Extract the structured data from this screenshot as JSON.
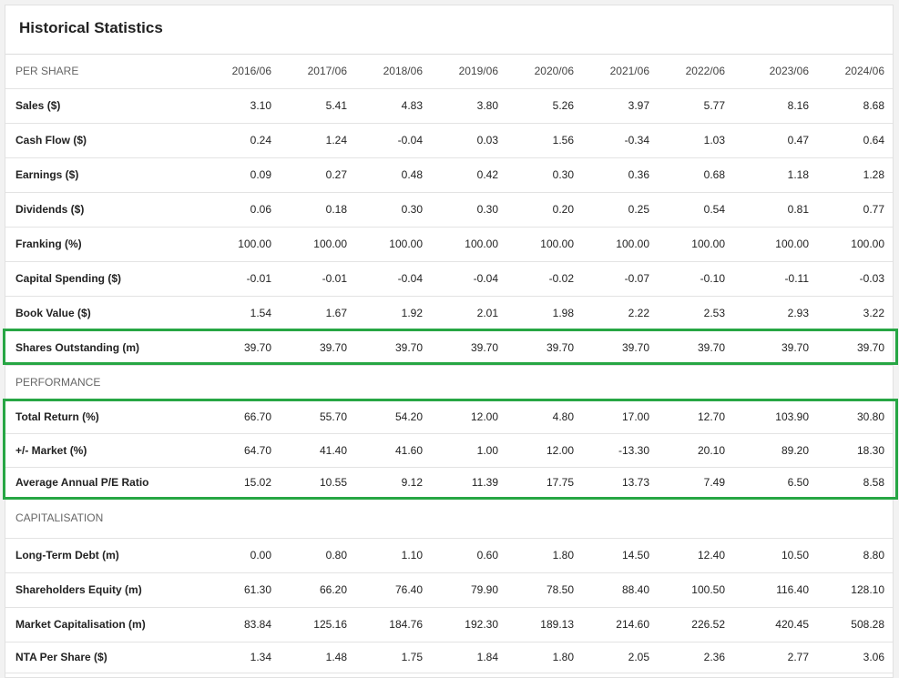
{
  "title": "Historical Statistics",
  "columns": [
    "2016/06",
    "2017/06",
    "2018/06",
    "2019/06",
    "2020/06",
    "2021/06",
    "2022/06",
    "2023/06",
    "2024/06"
  ],
  "highlight_color": "#27a644",
  "sections": {
    "per_share": {
      "label": "PER SHARE",
      "rows": [
        {
          "label": "Sales ($)",
          "values": [
            "3.10",
            "5.41",
            "4.83",
            "3.80",
            "5.26",
            "3.97",
            "5.77",
            "8.16",
            "8.68"
          ]
        },
        {
          "label": "Cash Flow ($)",
          "values": [
            "0.24",
            "1.24",
            "-0.04",
            "0.03",
            "1.56",
            "-0.34",
            "1.03",
            "0.47",
            "0.64"
          ]
        },
        {
          "label": "Earnings ($)",
          "values": [
            "0.09",
            "0.27",
            "0.48",
            "0.42",
            "0.30",
            "0.36",
            "0.68",
            "1.18",
            "1.28"
          ]
        },
        {
          "label": "Dividends ($)",
          "values": [
            "0.06",
            "0.18",
            "0.30",
            "0.30",
            "0.20",
            "0.25",
            "0.54",
            "0.81",
            "0.77"
          ]
        },
        {
          "label": "Franking (%)",
          "values": [
            "100.00",
            "100.00",
            "100.00",
            "100.00",
            "100.00",
            "100.00",
            "100.00",
            "100.00",
            "100.00"
          ]
        },
        {
          "label": "Capital Spending ($)",
          "values": [
            "-0.01",
            "-0.01",
            "-0.04",
            "-0.04",
            "-0.02",
            "-0.07",
            "-0.10",
            "-0.11",
            "-0.03"
          ]
        },
        {
          "label": "Book Value ($)",
          "values": [
            "1.54",
            "1.67",
            "1.92",
            "2.01",
            "1.98",
            "2.22",
            "2.53",
            "2.93",
            "3.22"
          ]
        },
        {
          "label": "Shares Outstanding (m)",
          "values": [
            "39.70",
            "39.70",
            "39.70",
            "39.70",
            "39.70",
            "39.70",
            "39.70",
            "39.70",
            "39.70"
          ]
        }
      ]
    },
    "performance": {
      "label": "PERFORMANCE",
      "rows": [
        {
          "label": "Total Return (%)",
          "values": [
            "66.70",
            "55.70",
            "54.20",
            "12.00",
            "4.80",
            "17.00",
            "12.70",
            "103.90",
            "30.80"
          ]
        },
        {
          "label": "+/- Market (%)",
          "values": [
            "64.70",
            "41.40",
            "41.60",
            "1.00",
            "12.00",
            "-13.30",
            "20.10",
            "89.20",
            "18.30"
          ]
        },
        {
          "label": "Average Annual P/E Ratio",
          "values": [
            "15.02",
            "10.55",
            "9.12",
            "11.39",
            "17.75",
            "13.73",
            "7.49",
            "6.50",
            "8.58"
          ]
        }
      ]
    },
    "capitalisation": {
      "label": "CAPITALISATION",
      "rows": [
        {
          "label": "Long-Term Debt (m)",
          "values": [
            "0.00",
            "0.80",
            "1.10",
            "0.60",
            "1.80",
            "14.50",
            "12.40",
            "10.50",
            "8.80"
          ]
        },
        {
          "label": "Shareholders Equity (m)",
          "values": [
            "61.30",
            "66.20",
            "76.40",
            "79.90",
            "78.50",
            "88.40",
            "100.50",
            "116.40",
            "128.10"
          ]
        },
        {
          "label": "Market Capitalisation (m)",
          "values": [
            "83.84",
            "125.16",
            "184.76",
            "192.30",
            "189.13",
            "214.60",
            "226.52",
            "420.45",
            "508.28"
          ]
        },
        {
          "label": "NTA Per Share ($)",
          "values": [
            "1.34",
            "1.48",
            "1.75",
            "1.84",
            "1.80",
            "2.05",
            "2.36",
            "2.77",
            "3.06"
          ]
        }
      ]
    }
  }
}
